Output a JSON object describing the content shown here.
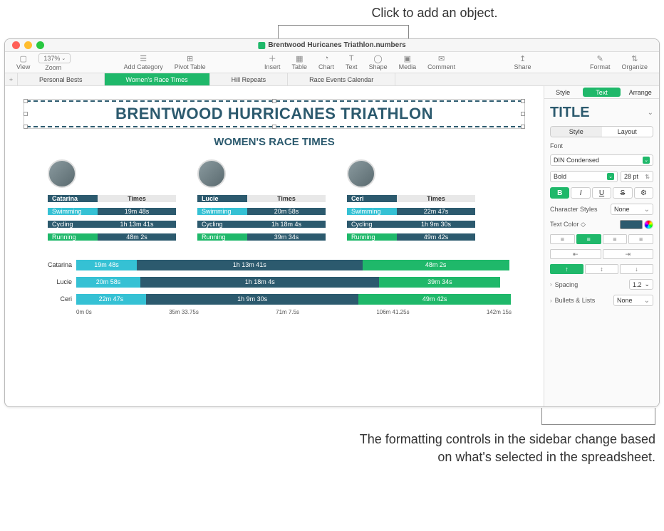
{
  "callouts": {
    "top": "Click to add an object.",
    "bottom": "The formatting controls in the sidebar change based on what's selected in the spreadsheet."
  },
  "titlebar": {
    "filename": "Brentwood Huricanes Triathlon.numbers"
  },
  "toolbar": {
    "view": "View",
    "zoom_label": "Zoom",
    "zoom_value": "137%",
    "add_category": "Add Category",
    "pivot_table": "Pivot Table",
    "insert": "Insert",
    "table": "Table",
    "chart": "Chart",
    "text": "Text",
    "shape": "Shape",
    "media": "Media",
    "comment": "Comment",
    "share": "Share",
    "format": "Format",
    "organize": "Organize"
  },
  "sheets": {
    "tabs": [
      "Personal Bests",
      "Women's Race Times",
      "Hill Repeats",
      "Race Events Calendar"
    ],
    "active_index": 1
  },
  "document": {
    "banner_title": "BRENTWOOD HURRICANES TRIATHLON",
    "subtitle": "WOMEN'S RACE TIMES",
    "times_label": "Times",
    "activities": [
      "Swimming",
      "Cycling",
      "Running"
    ],
    "athletes": [
      {
        "name": "Catarina",
        "swimming": "19m 48s",
        "cycling": "1h 13m 41s",
        "running": "48m 2s"
      },
      {
        "name": "Lucie",
        "swimming": "20m 58s",
        "cycling": "1h 18m 4s",
        "running": "39m 34s"
      },
      {
        "name": "Ceri",
        "swimming": "22m 47s",
        "cycling": "1h 9m 30s",
        "running": "49m 42s"
      }
    ]
  },
  "chart_data": {
    "type": "bar",
    "orientation": "horizontal-stacked",
    "categories": [
      "Catarina",
      "Lucie",
      "Ceri"
    ],
    "series": [
      {
        "name": "Swimming",
        "values_label": [
          "19m 48s",
          "20m 58s",
          "22m 47s"
        ],
        "values_sec": [
          1188,
          1258,
          1367
        ]
      },
      {
        "name": "Cycling",
        "values_label": [
          "1h 13m 41s",
          "1h 18m 4s",
          "1h 9m 30s"
        ],
        "values_sec": [
          4421,
          4684,
          4170
        ]
      },
      {
        "name": "Running",
        "values_label": [
          "48m 2s",
          "39m 34s",
          "49m 42s"
        ],
        "values_sec": [
          2882,
          2374,
          2982
        ]
      }
    ],
    "x_ticks": [
      "0m 0s",
      "35m 33.75s",
      "71m 7.5s",
      "106m 41.25s",
      "142m 15s"
    ],
    "xlim_sec": [
      0,
      8535
    ]
  },
  "sidebar": {
    "tabs": [
      "Style",
      "Text",
      "Arrange"
    ],
    "active_tab": 1,
    "title_preview": "TITLE",
    "subtabs": [
      "Style",
      "Layout"
    ],
    "active_subtab": 0,
    "font_label": "Font",
    "font_family": "DIN Condensed",
    "font_weight": "Bold",
    "font_size": "28 pt",
    "bold": "B",
    "italic": "I",
    "underline": "U",
    "strike": "S",
    "char_styles_label": "Character Styles",
    "char_styles_value": "None",
    "text_color_label": "Text Color",
    "text_color": "#2c5a6e",
    "spacing_label": "Spacing",
    "spacing_value": "1.2",
    "bullets_label": "Bullets & Lists",
    "bullets_value": "None"
  }
}
